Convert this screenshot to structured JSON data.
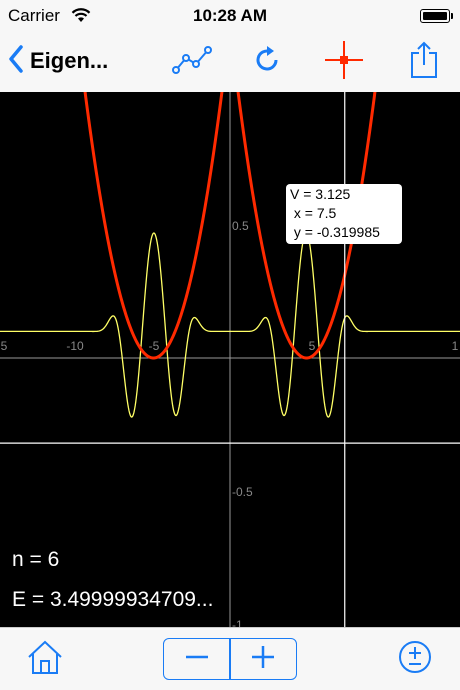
{
  "status": {
    "carrier": "Carrier",
    "time": "10:28 AM",
    "battery_level": 1.0
  },
  "nav": {
    "back_label": "Eigen...",
    "icons": [
      "chevron-left-icon",
      "graph-nodes-icon",
      "refresh-icon",
      "crosshair-icon",
      "share-icon"
    ]
  },
  "readout": {
    "v_line": "V = 3.125",
    "x_line": " x = 7.5",
    "y_line": " y = -0.319985"
  },
  "info": {
    "n_text": "n = 6",
    "e_text": "E = 3.49999934709..."
  },
  "axis": {
    "x_ticks": [
      "5",
      "-10",
      "-5",
      "5",
      "1"
    ],
    "y_ticks": [
      "0.5",
      "-0.5",
      "-1"
    ]
  },
  "chart_data": {
    "type": "line",
    "title": "",
    "xlabel": "",
    "ylabel": "",
    "xlim": [
      -15.3,
      15.3
    ],
    "ylim": [
      -1.0,
      1.0
    ],
    "crosshair": {
      "x": 7.5,
      "y": -0.319985
    },
    "series": [
      {
        "color": "#ff2a00",
        "kind": "potential"
      },
      {
        "color": "#ffff66",
        "kind": "wavefunction"
      }
    ],
    "energy_level": 3.5,
    "n": 6
  },
  "colors": {
    "accent": "#1a7cf5",
    "crosshair_red": "#ff2a00",
    "potential": "#ff2a00",
    "wavefunction": "#ffff66",
    "plot_bg": "#000000"
  },
  "toolbar": {
    "icons": [
      "home-icon",
      "minus-icon",
      "plus-icon",
      "plus-minus-icon"
    ]
  }
}
